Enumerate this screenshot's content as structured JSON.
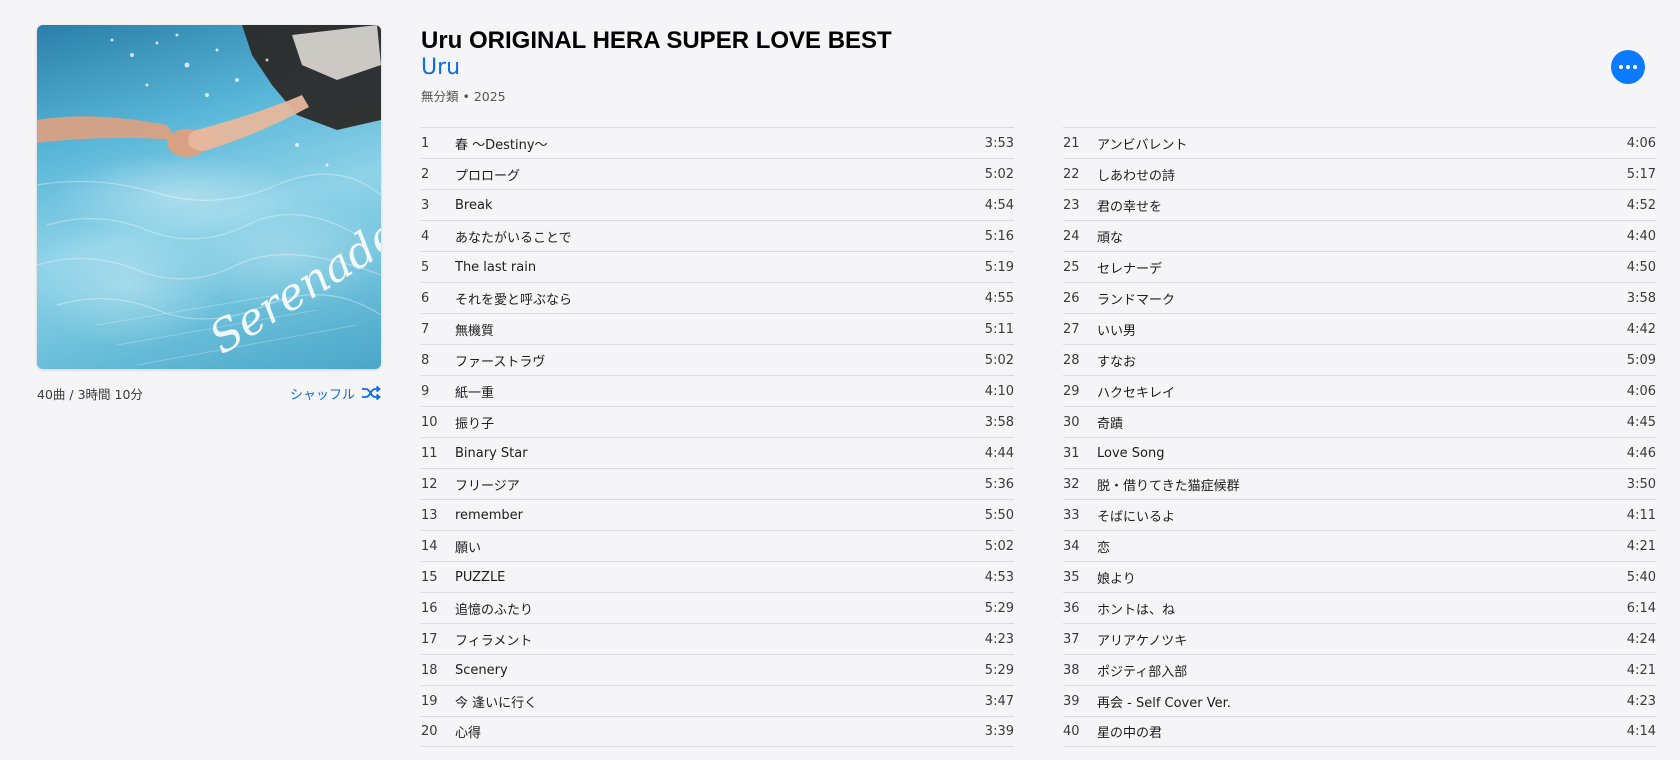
{
  "album": {
    "title": "Uru ORIGINAL HERA SUPER LOVE BEST",
    "artist": "Uru",
    "genre_year": "無分類 • 2025",
    "summary": "40曲 / 3時間 10分",
    "shuffle_label": "シャッフル",
    "artwork_text": "Serenade"
  },
  "colors": {
    "accent": "#0a6fe0",
    "more_button": "#0a7aff"
  },
  "tracks_col1": [
    {
      "num": "1",
      "name": "春 〜Destiny〜",
      "dur": "3:53"
    },
    {
      "num": "2",
      "name": "プロローグ",
      "dur": "5:02"
    },
    {
      "num": "3",
      "name": "Break",
      "dur": "4:54"
    },
    {
      "num": "4",
      "name": "あなたがいることで",
      "dur": "5:16"
    },
    {
      "num": "5",
      "name": "The last rain",
      "dur": "5:19"
    },
    {
      "num": "6",
      "name": "それを愛と呼ぶなら",
      "dur": "4:55"
    },
    {
      "num": "7",
      "name": "無機質",
      "dur": "5:11"
    },
    {
      "num": "8",
      "name": "ファーストラヴ",
      "dur": "5:02"
    },
    {
      "num": "9",
      "name": "紙一重",
      "dur": "4:10"
    },
    {
      "num": "10",
      "name": "振り子",
      "dur": "3:58"
    },
    {
      "num": "11",
      "name": "Binary Star",
      "dur": "4:44"
    },
    {
      "num": "12",
      "name": "フリージア",
      "dur": "5:36"
    },
    {
      "num": "13",
      "name": "remember",
      "dur": "5:50"
    },
    {
      "num": "14",
      "name": "願い",
      "dur": "5:02"
    },
    {
      "num": "15",
      "name": "PUZZLE",
      "dur": "4:53"
    },
    {
      "num": "16",
      "name": "追憶のふたり",
      "dur": "5:29"
    },
    {
      "num": "17",
      "name": "フィラメント",
      "dur": "4:23"
    },
    {
      "num": "18",
      "name": "Scenery",
      "dur": "5:29"
    },
    {
      "num": "19",
      "name": "今 逢いに行く",
      "dur": "3:47"
    },
    {
      "num": "20",
      "name": "心得",
      "dur": "3:39"
    }
  ],
  "tracks_col2": [
    {
      "num": "21",
      "name": "アンビバレント",
      "dur": "4:06"
    },
    {
      "num": "22",
      "name": "しあわせの詩",
      "dur": "5:17"
    },
    {
      "num": "23",
      "name": "君の幸せを",
      "dur": "4:52"
    },
    {
      "num": "24",
      "name": "頑な",
      "dur": "4:40"
    },
    {
      "num": "25",
      "name": "セレナーデ",
      "dur": "4:50"
    },
    {
      "num": "26",
      "name": "ランドマーク",
      "dur": "3:58"
    },
    {
      "num": "27",
      "name": "いい男",
      "dur": "4:42"
    },
    {
      "num": "28",
      "name": "すなお",
      "dur": "5:09"
    },
    {
      "num": "29",
      "name": "ハクセキレイ",
      "dur": "4:06"
    },
    {
      "num": "30",
      "name": "奇蹟",
      "dur": "4:45"
    },
    {
      "num": "31",
      "name": "Love Song",
      "dur": "4:46"
    },
    {
      "num": "32",
      "name": "脱・借りてきた猫症候群",
      "dur": "3:50"
    },
    {
      "num": "33",
      "name": "そばにいるよ",
      "dur": "4:11"
    },
    {
      "num": "34",
      "name": "恋",
      "dur": "4:21"
    },
    {
      "num": "35",
      "name": "娘より",
      "dur": "5:40"
    },
    {
      "num": "36",
      "name": "ホントは、ね",
      "dur": "6:14"
    },
    {
      "num": "37",
      "name": "アリアケノツキ",
      "dur": "4:24"
    },
    {
      "num": "38",
      "name": "ポジティ部入部",
      "dur": "4:21"
    },
    {
      "num": "39",
      "name": "再会 - Self Cover Ver.",
      "dur": "4:23"
    },
    {
      "num": "40",
      "name": "星の中の君",
      "dur": "4:14"
    }
  ]
}
